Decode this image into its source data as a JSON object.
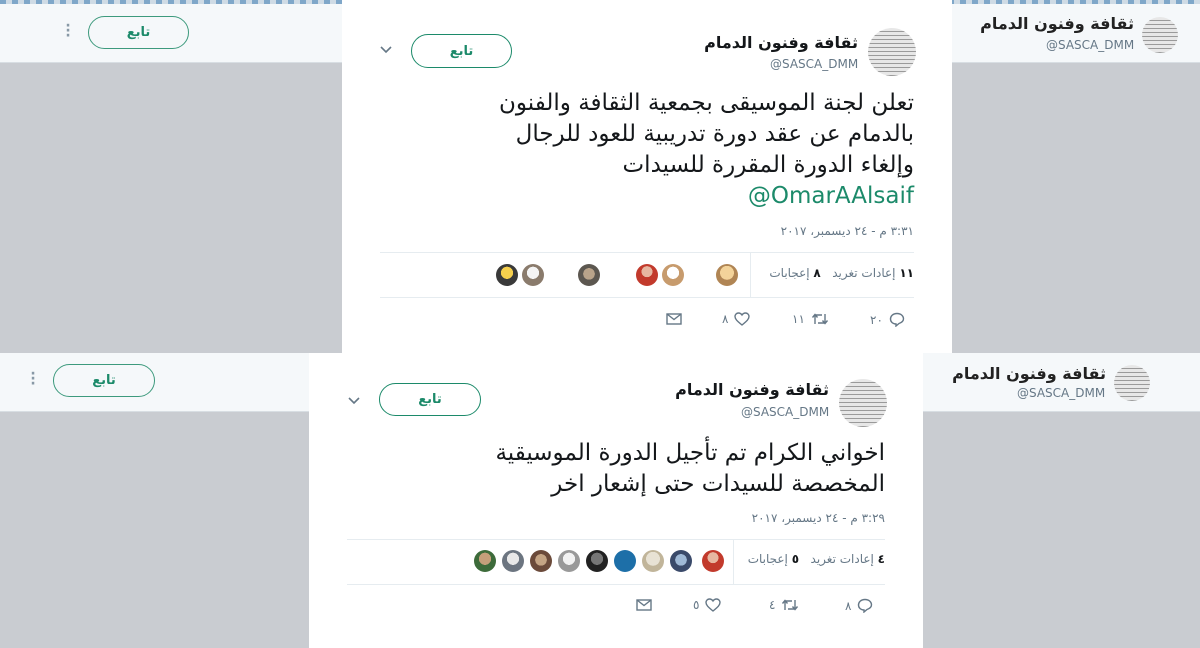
{
  "account": {
    "name": "ثقافة وفنون الدمام",
    "handle": "@SASCA_DMM",
    "follow_label": "تابع",
    "logo_text": "ثقافة وفنون الدمام"
  },
  "tweets": [
    {
      "text_lines": [
        "تعلن لجنة الموسيقى بجمعية الثقافة والفنون",
        "بالدمام عن  عقد دورة تدريبية للعود للرجال",
        "وإلغاء الدورة المقررة للسيدات"
      ],
      "mention": "@OmarAAlsaif",
      "timestamp": "٣:٣١ م - ٢٤ ديسمبر، ٢٠١٧",
      "retweets_count": "١١",
      "retweets_label": "إعادات تغريد",
      "likes_count": "٨",
      "likes_label": "إعجابات",
      "actions": {
        "reply": "٢٠",
        "retweet": "١١",
        "like": "٨"
      }
    },
    {
      "text_lines": [
        "اخواني الكرام تم تأجيل الدورة الموسيقية",
        "المخصصة للسيدات حتى إشعار اخر"
      ],
      "timestamp": "٣:٢٩ م - ٢٤ ديسمبر، ٢٠١٧",
      "retweets_count": "٤",
      "retweets_label": "إعادات تغريد",
      "likes_count": "٥",
      "likes_label": "إعجابات",
      "actions": {
        "reply": "٨",
        "retweet": "٤",
        "like": "٥"
      }
    }
  ],
  "colors": {
    "accent": "#1c8a6a",
    "text": "#14171a",
    "muted": "#657786",
    "backdrop": "#c9ccd1"
  },
  "icons": [
    "reply-icon",
    "retweet-icon",
    "like-icon",
    "message-icon",
    "chevron-down-icon",
    "more-dots-icon"
  ]
}
